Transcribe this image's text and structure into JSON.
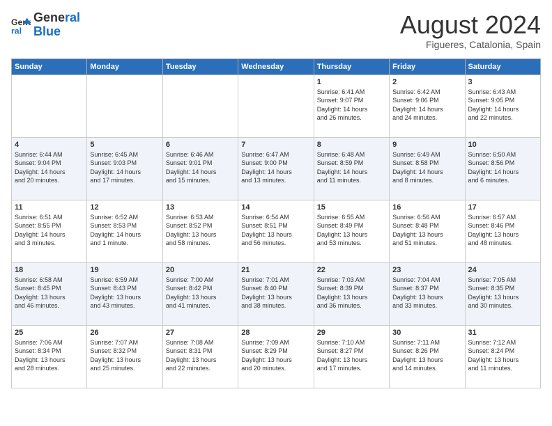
{
  "logo": {
    "line1": "General",
    "line2": "Blue"
  },
  "title": "August 2024",
  "location": "Figueres, Catalonia, Spain",
  "weekdays": [
    "Sunday",
    "Monday",
    "Tuesday",
    "Wednesday",
    "Thursday",
    "Friday",
    "Saturday"
  ],
  "weeks": [
    [
      {
        "day": "",
        "content": ""
      },
      {
        "day": "",
        "content": ""
      },
      {
        "day": "",
        "content": ""
      },
      {
        "day": "",
        "content": ""
      },
      {
        "day": "1",
        "content": "Sunrise: 6:41 AM\nSunset: 9:07 PM\nDaylight: 14 hours\nand 26 minutes."
      },
      {
        "day": "2",
        "content": "Sunrise: 6:42 AM\nSunset: 9:06 PM\nDaylight: 14 hours\nand 24 minutes."
      },
      {
        "day": "3",
        "content": "Sunrise: 6:43 AM\nSunset: 9:05 PM\nDaylight: 14 hours\nand 22 minutes."
      }
    ],
    [
      {
        "day": "4",
        "content": "Sunrise: 6:44 AM\nSunset: 9:04 PM\nDaylight: 14 hours\nand 20 minutes."
      },
      {
        "day": "5",
        "content": "Sunrise: 6:45 AM\nSunset: 9:03 PM\nDaylight: 14 hours\nand 17 minutes."
      },
      {
        "day": "6",
        "content": "Sunrise: 6:46 AM\nSunset: 9:01 PM\nDaylight: 14 hours\nand 15 minutes."
      },
      {
        "day": "7",
        "content": "Sunrise: 6:47 AM\nSunset: 9:00 PM\nDaylight: 14 hours\nand 13 minutes."
      },
      {
        "day": "8",
        "content": "Sunrise: 6:48 AM\nSunset: 8:59 PM\nDaylight: 14 hours\nand 11 minutes."
      },
      {
        "day": "9",
        "content": "Sunrise: 6:49 AM\nSunset: 8:58 PM\nDaylight: 14 hours\nand 8 minutes."
      },
      {
        "day": "10",
        "content": "Sunrise: 6:50 AM\nSunset: 8:56 PM\nDaylight: 14 hours\nand 6 minutes."
      }
    ],
    [
      {
        "day": "11",
        "content": "Sunrise: 6:51 AM\nSunset: 8:55 PM\nDaylight: 14 hours\nand 3 minutes."
      },
      {
        "day": "12",
        "content": "Sunrise: 6:52 AM\nSunset: 8:53 PM\nDaylight: 14 hours\nand 1 minute."
      },
      {
        "day": "13",
        "content": "Sunrise: 6:53 AM\nSunset: 8:52 PM\nDaylight: 13 hours\nand 58 minutes."
      },
      {
        "day": "14",
        "content": "Sunrise: 6:54 AM\nSunset: 8:51 PM\nDaylight: 13 hours\nand 56 minutes."
      },
      {
        "day": "15",
        "content": "Sunrise: 6:55 AM\nSunset: 8:49 PM\nDaylight: 13 hours\nand 53 minutes."
      },
      {
        "day": "16",
        "content": "Sunrise: 6:56 AM\nSunset: 8:48 PM\nDaylight: 13 hours\nand 51 minutes."
      },
      {
        "day": "17",
        "content": "Sunrise: 6:57 AM\nSunset: 8:46 PM\nDaylight: 13 hours\nand 48 minutes."
      }
    ],
    [
      {
        "day": "18",
        "content": "Sunrise: 6:58 AM\nSunset: 8:45 PM\nDaylight: 13 hours\nand 46 minutes."
      },
      {
        "day": "19",
        "content": "Sunrise: 6:59 AM\nSunset: 8:43 PM\nDaylight: 13 hours\nand 43 minutes."
      },
      {
        "day": "20",
        "content": "Sunrise: 7:00 AM\nSunset: 8:42 PM\nDaylight: 13 hours\nand 41 minutes."
      },
      {
        "day": "21",
        "content": "Sunrise: 7:01 AM\nSunset: 8:40 PM\nDaylight: 13 hours\nand 38 minutes."
      },
      {
        "day": "22",
        "content": "Sunrise: 7:03 AM\nSunset: 8:39 PM\nDaylight: 13 hours\nand 36 minutes."
      },
      {
        "day": "23",
        "content": "Sunrise: 7:04 AM\nSunset: 8:37 PM\nDaylight: 13 hours\nand 33 minutes."
      },
      {
        "day": "24",
        "content": "Sunrise: 7:05 AM\nSunset: 8:35 PM\nDaylight: 13 hours\nand 30 minutes."
      }
    ],
    [
      {
        "day": "25",
        "content": "Sunrise: 7:06 AM\nSunset: 8:34 PM\nDaylight: 13 hours\nand 28 minutes."
      },
      {
        "day": "26",
        "content": "Sunrise: 7:07 AM\nSunset: 8:32 PM\nDaylight: 13 hours\nand 25 minutes."
      },
      {
        "day": "27",
        "content": "Sunrise: 7:08 AM\nSunset: 8:31 PM\nDaylight: 13 hours\nand 22 minutes."
      },
      {
        "day": "28",
        "content": "Sunrise: 7:09 AM\nSunset: 8:29 PM\nDaylight: 13 hours\nand 20 minutes."
      },
      {
        "day": "29",
        "content": "Sunrise: 7:10 AM\nSunset: 8:27 PM\nDaylight: 13 hours\nand 17 minutes."
      },
      {
        "day": "30",
        "content": "Sunrise: 7:11 AM\nSunset: 8:26 PM\nDaylight: 13 hours\nand 14 minutes."
      },
      {
        "day": "31",
        "content": "Sunrise: 7:12 AM\nSunset: 8:24 PM\nDaylight: 13 hours\nand 11 minutes."
      }
    ]
  ]
}
